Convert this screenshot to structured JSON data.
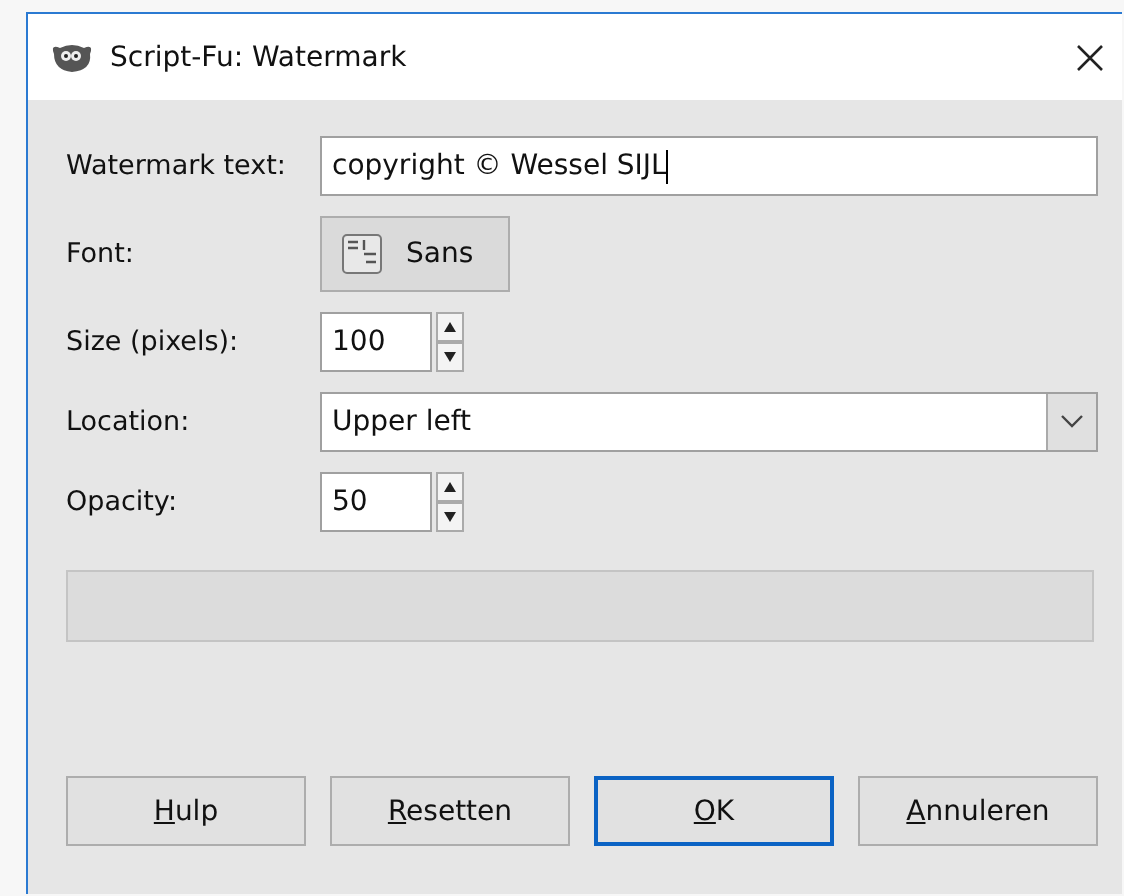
{
  "window": {
    "title": "Script-Fu: Watermark"
  },
  "fields": [
    {
      "kind": "text",
      "label": "Watermark text:",
      "value": "copyright © Wessel SIJL"
    },
    {
      "kind": "font",
      "label": "Font:",
      "value": "Sans"
    },
    {
      "kind": "spin",
      "label": "Size (pixels):",
      "value": "100"
    },
    {
      "kind": "combo",
      "label": "Location:",
      "value": "Upper left"
    },
    {
      "kind": "spin",
      "label": "Opacity:",
      "value": "50"
    }
  ],
  "progress": {
    "level": 0
  },
  "buttons": [
    {
      "accel": "H",
      "rest": "ulp",
      "default": false
    },
    {
      "accel": "R",
      "rest": "esetten",
      "default": false
    },
    {
      "accel": "O",
      "rest": "K",
      "default": true
    },
    {
      "accel": "A",
      "rest": "nnuleren",
      "default": false
    }
  ]
}
